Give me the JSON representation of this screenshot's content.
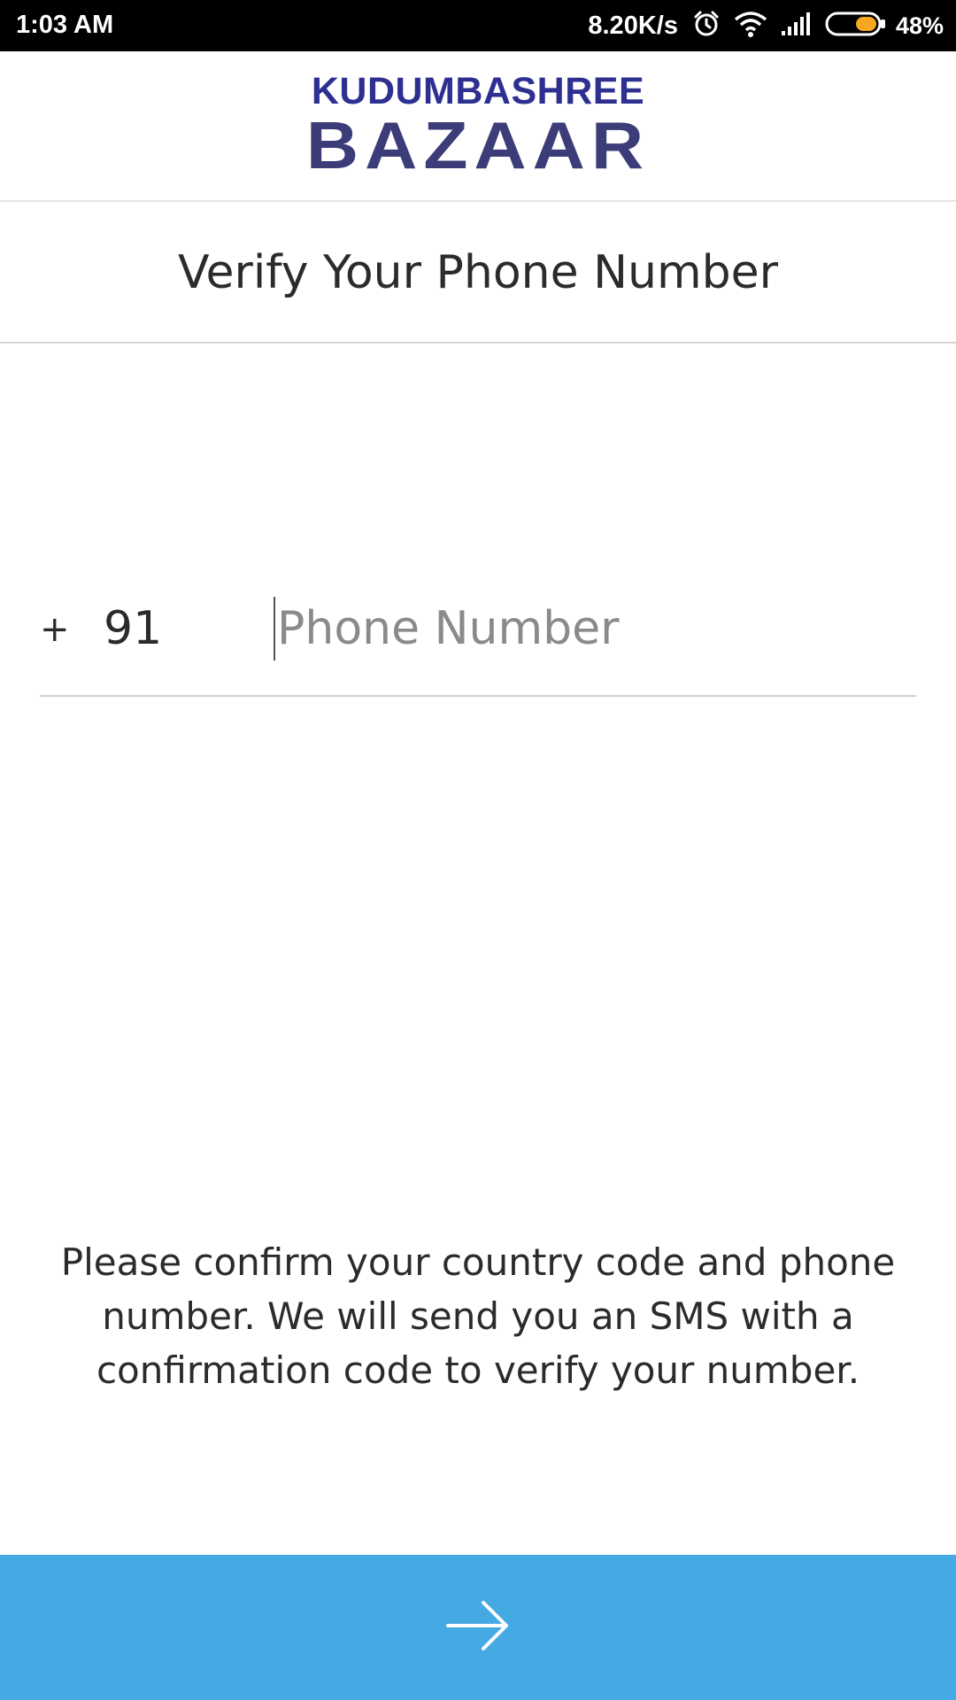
{
  "status_bar": {
    "time": "1:03 AM",
    "network_speed": "8.20K/s",
    "battery_percent": "48%",
    "battery_level": 0.48,
    "icons": [
      "alarm-icon",
      "wifi-icon",
      "signal-icon",
      "battery-icon"
    ]
  },
  "header": {
    "logo_line1": "KUDUMBASHREE",
    "logo_line2": "BAZAAR",
    "logo_color_top": "#2d3090",
    "logo_color_bottom": "#3c3d78"
  },
  "page": {
    "title": "Verify Your Phone Number"
  },
  "phone_form": {
    "plus_sign": "+",
    "country_code": "91",
    "phone_placeholder": "Phone Number",
    "phone_value": ""
  },
  "info": {
    "message": "Please confirm your country code and phone number. We will send you an SMS with a confirmation code to verify your number."
  },
  "next_button": {
    "icon": "arrow-right-icon",
    "color": "#45aae3"
  }
}
